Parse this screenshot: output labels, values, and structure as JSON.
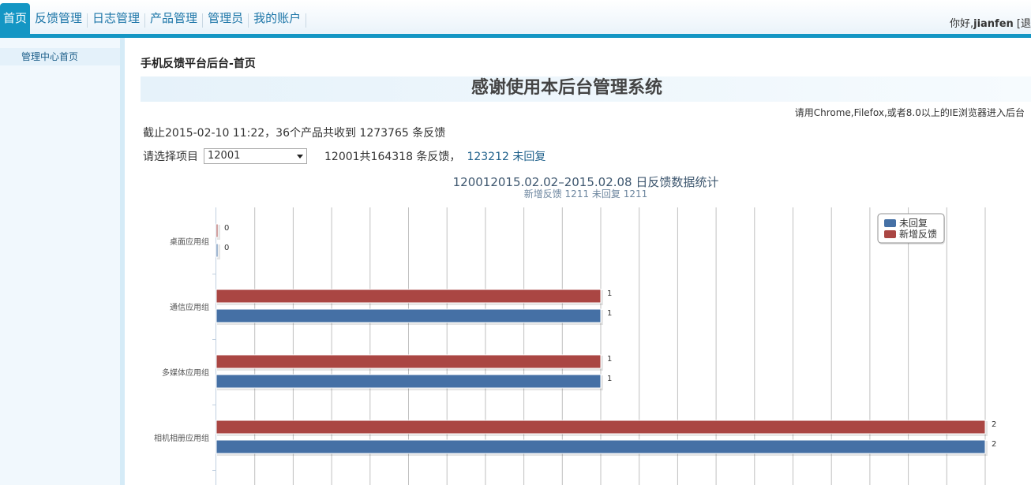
{
  "nav": {
    "items": [
      {
        "label": "首页",
        "active": true
      },
      {
        "label": "反馈管理",
        "active": false
      },
      {
        "label": "日志管理",
        "active": false
      },
      {
        "label": "产品管理",
        "active": false
      },
      {
        "label": "管理员",
        "active": false
      },
      {
        "label": "我的账户",
        "active": false
      }
    ],
    "greeting_prefix": "你好,",
    "username": "jianfen",
    "logout": "[退"
  },
  "sidebar": {
    "items": [
      {
        "label": "管理中心首页"
      }
    ]
  },
  "main": {
    "breadcrumb": "手机反馈平台后台-首页",
    "welcome": "感谢使用本后台管理系统",
    "browser_tip": "请用Chrome,Filefox,或者8.0以上的IE浏览器进入后台",
    "summary": "截止2015-02-10 11:22，36个产品共收到 1273765 条反馈",
    "select_label": "请选择项目",
    "selected_project": "12001",
    "project_count": "12001共164318 条反馈，",
    "unreplied": "123212 未回复"
  },
  "colors": {
    "accent": "#1496c4",
    "series_unreplied": "#4570a5",
    "series_new": "#aa4643"
  },
  "chart_data": {
    "type": "bar",
    "orientation": "horizontal",
    "title": "12001 2015.02.02–2015.02.08 日反馈数据统计",
    "title_display": "120012015.02.02–2015.02.08 日反馈数据统计",
    "subtitle": "新增反馈  1211 未回复  1211",
    "categories": [
      "桌面应用组",
      "通信应用组",
      "多媒体应用组",
      "相机相册应用组"
    ],
    "series": [
      {
        "name": "新增反馈",
        "color": "#aa4643",
        "values": [
          0,
          1,
          1,
          2
        ]
      },
      {
        "name": "未回复",
        "color": "#4570a5",
        "values": [
          0,
          1,
          1,
          2
        ]
      }
    ],
    "legend_order": [
      "未回复",
      "新增反馈"
    ],
    "legend_placement": "top-right",
    "xlim": [
      0,
      2
    ],
    "grid": true
  }
}
